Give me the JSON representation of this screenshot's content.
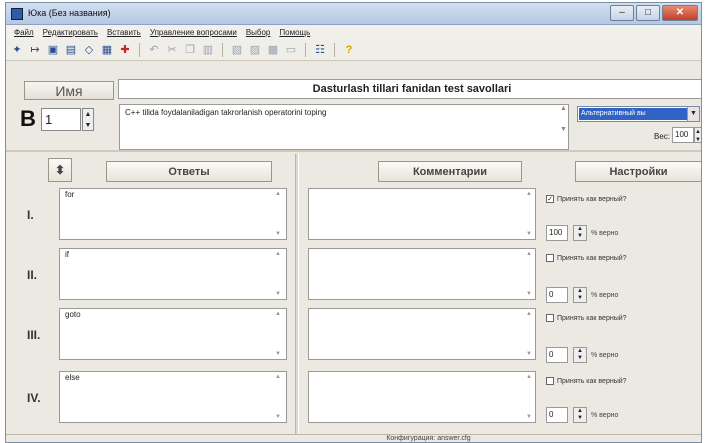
{
  "window": {
    "title": "Юка (Без названия)",
    "controls": [
      "–",
      "□",
      "✕"
    ]
  },
  "menu": [
    "Файл",
    "Редактировать",
    "Вставить",
    "Управление вопросами",
    "Выбор",
    "Помощь"
  ],
  "toolbar": {
    "icons": [
      "new-file-icon",
      "open-file-icon",
      "save-icon",
      "save-as-icon",
      "settings-icon",
      "grid-icon",
      "add-icon",
      "undo-icon",
      "cut-icon",
      "copy-icon",
      "paste-icon",
      "delete-icon",
      "format-icon",
      "preview-icon",
      "monitor-icon",
      "help-icon"
    ]
  },
  "header": {
    "name_button": "Имя",
    "test_title": "Dasturlash tillari fanidan test savollari"
  },
  "question": {
    "prefix": "В",
    "number": "1",
    "text": "C++ tilida foydalaniladigan takrorlanish operatorini toping",
    "type": "Альтернативный вы",
    "weight_label": "Вес:",
    "weight": "100"
  },
  "columns": {
    "sort_icon": "sort-updown-icon",
    "answers": "Ответы",
    "comments": "Комментарии",
    "settings": "Настройки"
  },
  "answers": [
    {
      "roman": "I.",
      "text": "for",
      "correct_label": "Принять как верный?",
      "checked": true,
      "percent": "100",
      "percent_label": "% верно"
    },
    {
      "roman": "II.",
      "text": "if",
      "correct_label": "Принять как верный?",
      "checked": false,
      "percent": "0",
      "percent_label": "% верно"
    },
    {
      "roman": "III.",
      "text": "goto",
      "correct_label": "Принять как верный?",
      "checked": false,
      "percent": "0",
      "percent_label": "% верно"
    },
    {
      "roman": "IV.",
      "text": "else",
      "correct_label": "Принять как верный?",
      "checked": false,
      "percent": "0",
      "percent_label": "% верно"
    }
  ],
  "status": "Конфигурация: answer.cfg"
}
